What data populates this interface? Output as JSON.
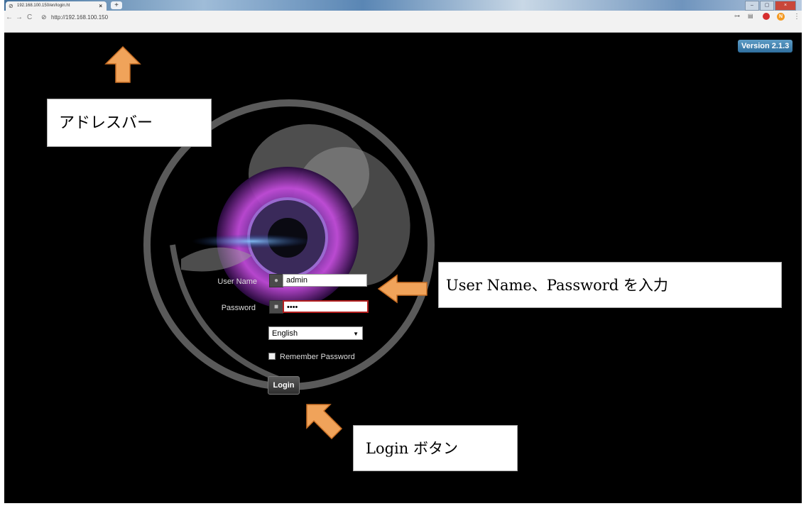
{
  "browser": {
    "tab_title": "192.168.100.150/en/login.ht",
    "tab_close": "×",
    "new_tab": "+",
    "url": "http://192.168.100.150",
    "ext_n_label": "N"
  },
  "page": {
    "version": "Version 2.1.3",
    "username_label": "User Name",
    "username_value": "admin",
    "password_label": "Password",
    "password_value": "••••",
    "language_selected": "English",
    "remember_label": "Remember Password",
    "login_label": "Login"
  },
  "annotations": {
    "address_bar": "アドレスバー",
    "credentials": "User Name、Password を入力",
    "login_button": "Login ボタン",
    "arrow_color": "#f0a35a"
  }
}
